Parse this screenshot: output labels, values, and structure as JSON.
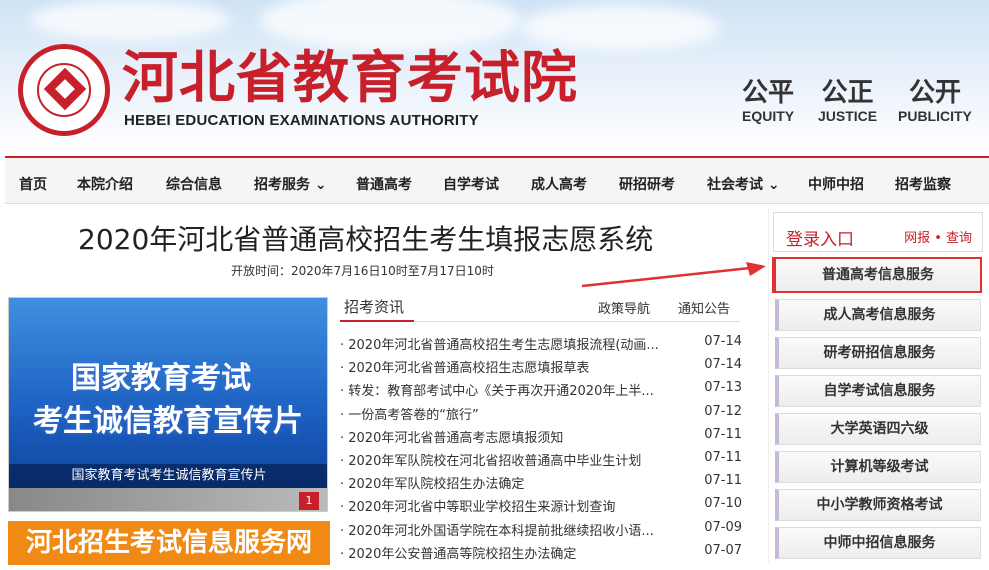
{
  "header": {
    "title_cn": "河北省教育考试院",
    "title_en": "HEBEI EDUCATION EXAMINATIONS AUTHORITY",
    "motto": [
      {
        "cn": "公平",
        "en": "EQUITY"
      },
      {
        "cn": "公正",
        "en": "JUSTICE"
      },
      {
        "cn": "公开",
        "en": "PUBLICITY"
      }
    ]
  },
  "nav": {
    "items": [
      "首页",
      "本院介绍",
      "综合信息",
      "招考服务 ⌄",
      "普通高考",
      "自学考试",
      "成人高考",
      "研招研考",
      "社会考试 ⌄",
      "中师中招",
      "招考监察"
    ]
  },
  "main": {
    "title": "2020年河北省普通高校招生考生填报志愿系统",
    "open_time": "开放时间：2020年7月16日10时至7月17日10时"
  },
  "video": {
    "line1": "国家教育考试",
    "line2": "考生诚信教育宣传片",
    "caption": "国家教育考试考生诚信教育宣传片",
    "page": "1"
  },
  "service_banner": "河北招生考试信息服务网",
  "news": {
    "tab_active": "招考资讯",
    "tabs": [
      "政策导航",
      "通知公告"
    ],
    "items": [
      {
        "title": "· 2020年河北省普通高校招生考生志愿填报流程(动画...",
        "date": "07-14"
      },
      {
        "title": "· 2020年河北省普通高校招生志愿填报草表",
        "date": "07-14"
      },
      {
        "title": "· 转发：教育部考试中心《关于再次开通2020年上半...",
        "date": "07-13"
      },
      {
        "title": "· 一份高考答卷的“旅行”",
        "date": "07-12"
      },
      {
        "title": "· 2020年河北省普通高考志愿填报须知",
        "date": "07-11"
      },
      {
        "title": "· 2020年军队院校在河北省招收普通高中毕业生计划",
        "date": "07-11"
      },
      {
        "title": "· 2020年军队院校招生办法确定",
        "date": "07-11"
      },
      {
        "title": "· 2020年河北省中等职业学校招生来源计划查询",
        "date": "07-10"
      },
      {
        "title": "· 2020年河北外国语学院在本科提前批继续招收小语...",
        "date": "07-09"
      },
      {
        "title": "· 2020年公安普通高等院校招生办法确定",
        "date": "07-07"
      }
    ]
  },
  "login": {
    "title": "登录入口",
    "links": "网报 • 查询"
  },
  "side_buttons": [
    "普通高考信息服务",
    "成人高考信息服务",
    "研考研招信息服务",
    "自学考试信息服务",
    "大学英语四六级",
    "计算机等级考试",
    "中小学教师资格考试",
    "中师中招信息服务"
  ],
  "colors": {
    "brand_red": "#c8202a",
    "orange": "#f08a14",
    "highlight": "#e03030"
  }
}
